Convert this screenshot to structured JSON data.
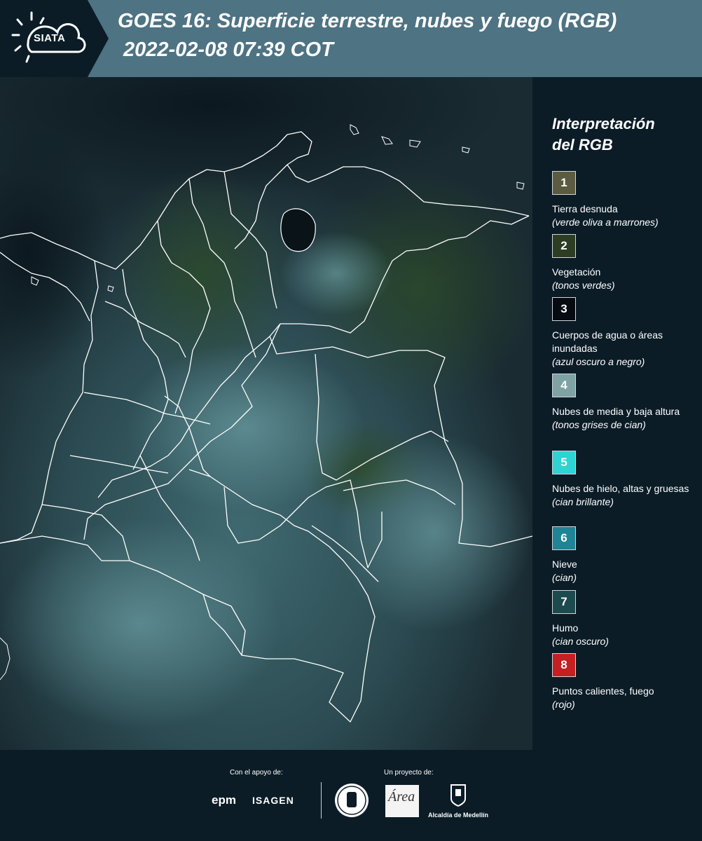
{
  "header": {
    "logo_text": "SIATA",
    "title": "GOES 16: Superficie terrestre, nubes y fuego (RGB)",
    "datetime": "2022-02-08 07:39 COT"
  },
  "legend": {
    "title_line1": "Interpretación",
    "title_line2": "del RGB",
    "items": [
      {
        "num": "1",
        "label": "Tierra desnuda",
        "sub": "(verde oliva a marrones)",
        "color": "#5b5b41"
      },
      {
        "num": "2",
        "label": "Vegetación",
        "sub": "(tonos verdes)",
        "color": "#2c3d22"
      },
      {
        "num": "3",
        "label": "Cuerpos de agua o áreas inundadas",
        "sub": "(azul oscuro a negro)",
        "color": "#050b10"
      },
      {
        "num": "4",
        "label": "Nubes de media y baja altura",
        "sub": "(tonos grises de cian)",
        "color": "#7fa3a4"
      },
      {
        "num": "5",
        "label": "Nubes de hielo, altas y gruesas",
        "sub": "(cian brillante)",
        "color": "#2ed3d3"
      },
      {
        "num": "6",
        "label": "Nieve",
        "sub": "(cian)",
        "color": "#1f8494"
      },
      {
        "num": "7",
        "label": "Humo",
        "sub": "(cian oscuro)",
        "color": "#1d4a4e"
      },
      {
        "num": "8",
        "label": "Puntos calientes, fuego",
        "sub": "(rojo)",
        "color": "#c41f22"
      }
    ]
  },
  "footer": {
    "support_label": "Con el apoyo de:",
    "project_label": "Un proyecto de:",
    "epm": "epm",
    "isagen": "ISAGEN",
    "alcaldia": "Alcaldía de Medellín"
  }
}
